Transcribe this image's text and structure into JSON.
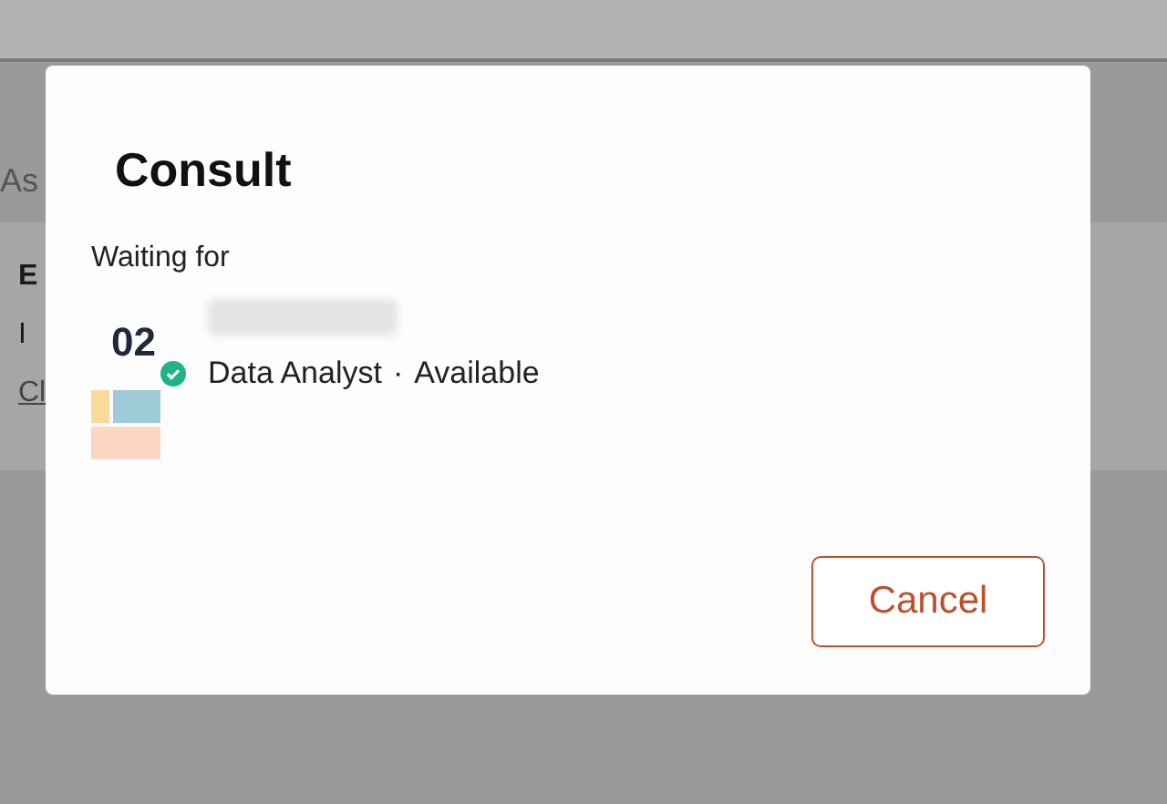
{
  "background": {
    "heading": "As",
    "card_title": "E",
    "card_text": "I",
    "card_link": "Cl"
  },
  "dialog": {
    "title": "Consult",
    "subtitle": "Waiting for",
    "contact": {
      "avatar": "02",
      "online": true,
      "role": "Data Analyst",
      "separator": "·",
      "status": "Available"
    },
    "buttons": [
      "Cancel"
    ]
  }
}
